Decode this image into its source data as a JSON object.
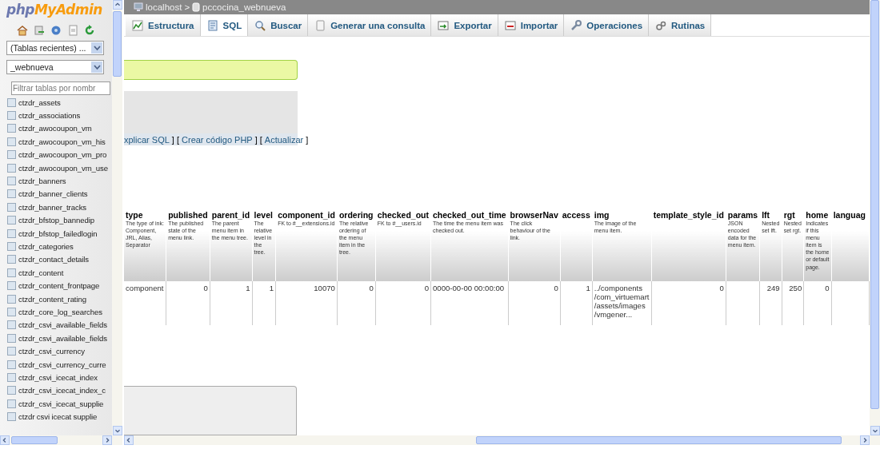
{
  "sidebar": {
    "logo": {
      "prefix": "php",
      "name": "MyAdmin"
    },
    "selects": [
      {
        "value": "(Tablas recientes) ..."
      },
      {
        "value": "_webnueva"
      }
    ],
    "filter": {
      "placeholder": "Filtrar tablas por nombr"
    },
    "tables": [
      "ctzdr_assets",
      "ctzdr_associations",
      "ctzdr_awocoupon_vm",
      "ctzdr_awocoupon_vm_his",
      "ctzdr_awocoupon_vm_pro",
      "ctzdr_awocoupon_vm_use",
      "ctzdr_banners",
      "ctzdr_banner_clients",
      "ctzdr_banner_tracks",
      "ctzdr_bfstop_bannedip",
      "ctzdr_bfstop_failedlogin",
      "ctzdr_categories",
      "ctzdr_contact_details",
      "ctzdr_content",
      "ctzdr_content_frontpage",
      "ctzdr_content_rating",
      "ctzdr_core_log_searches",
      "ctzdr_csvi_available_fields",
      "ctzdr_csvi_available_fields",
      "ctzdr_csvi_currency",
      "ctzdr_csvi_currency_curre",
      "ctzdr_csvi_icecat_index",
      "ctzdr_csvi_icecat_index_c",
      "ctzdr_csvi_icecat_supplie",
      "ctzdr csvi icecat supplie"
    ]
  },
  "breadcrumb": {
    "items": [
      {
        "text": "localhost"
      },
      {
        "text": "pccocina_webnueva"
      }
    ],
    "separator": ">"
  },
  "tabs": [
    {
      "label": "Estructura",
      "selected": false
    },
    {
      "label": "SQL",
      "selected": true
    },
    {
      "label": "Buscar",
      "selected": false
    },
    {
      "label": "Generar una consulta",
      "selected": false
    },
    {
      "label": "Exportar",
      "selected": false
    },
    {
      "label": "Importar",
      "selected": false
    },
    {
      "label": "Operaciones",
      "selected": false
    },
    {
      "label": "Rutinas",
      "selected": false
    }
  ],
  "query_links": [
    {
      "kind": "link",
      "text": "xplicar SQL"
    },
    {
      "kind": "separator",
      "text": "] ["
    },
    {
      "kind": "link",
      "text": "Crear código PHP"
    },
    {
      "kind": "separator",
      "text": "] ["
    },
    {
      "kind": "link",
      "text": "Actualizar"
    },
    {
      "kind": "separator",
      "text": "]"
    }
  ],
  "table": {
    "columns": [
      {
        "name": "type",
        "description": "The type of ink: Component, JRL, Alias, Separator"
      },
      {
        "name": "published",
        "description": "The published state of the menu link."
      },
      {
        "name": "parent_id",
        "description": "The parent menu item in the menu tree."
      },
      {
        "name": "level",
        "description": "The relative level in the tree."
      },
      {
        "name": "component_id",
        "description": "FK to #__extensions.id"
      },
      {
        "name": "ordering",
        "description": "The relative ordering of the menu item in the tree."
      },
      {
        "name": "checked_out",
        "description": "FK to #__users.id"
      },
      {
        "name": "checked_out_time",
        "description": "The time the menu item was checked out."
      },
      {
        "name": "browserNav",
        "description": "The click behaviour of the link."
      },
      {
        "name": "access"
      },
      {
        "name": "img",
        "description": "The image of the menu item."
      },
      {
        "name": "template_style_id"
      },
      {
        "name": "params",
        "description": "JSON encoded data for the menu item."
      },
      {
        "name": "lft",
        "description": "Nested set lft."
      },
      {
        "name": "rgt",
        "description": "Nested set rgt."
      },
      {
        "name": "home",
        "description": "Indicates if this menu item is the home or default page."
      },
      {
        "name": "languag"
      }
    ],
    "rows": [
      {
        "cells": [
          "component",
          "0",
          "1",
          "1",
          "10070",
          "0",
          "0",
          "0000-00-00 00:00:00",
          "0",
          "1",
          "../components /com_virtuemart /assets/images /vmgener...",
          "0",
          null,
          "249",
          "250",
          "0",
          null
        ]
      }
    ]
  }
}
